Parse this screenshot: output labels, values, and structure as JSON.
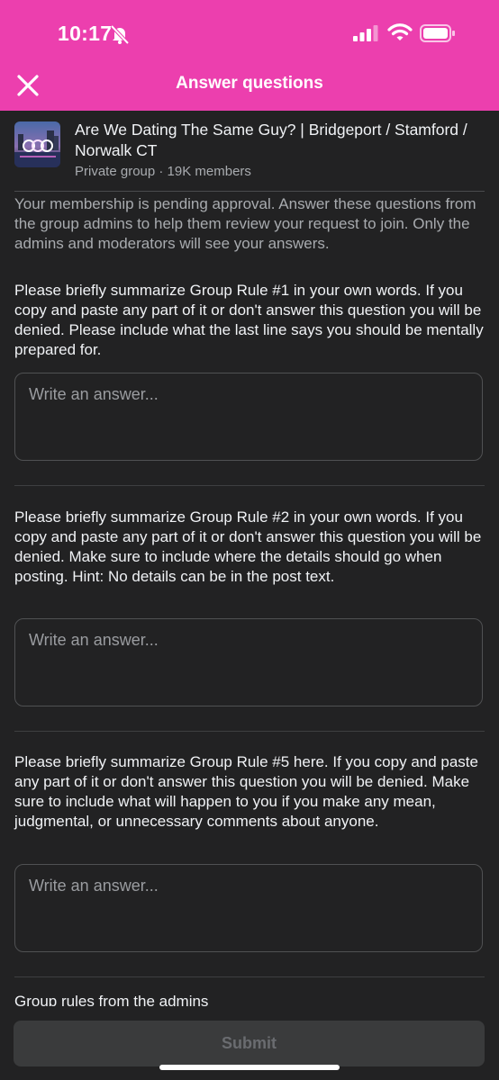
{
  "status_bar": {
    "time": "10:17",
    "icons": [
      "bell-slash-icon",
      "signal-icon",
      "wifi-icon",
      "battery-icon"
    ]
  },
  "header": {
    "title": "Answer questions",
    "close_icon": "close-icon",
    "background_color": "#ec3fae"
  },
  "group": {
    "name": "Are We Dating The Same Guy? | Bridgeport / Stamford / Norwalk CT",
    "meta": "Private group · 19K members"
  },
  "intro": "Your membership is pending approval. Answer these questions from the group admins to help them review your request to join. Only the admins and moderators will see your answers.",
  "questions": [
    {
      "text": "Please briefly summarize Group Rule #1 in your own words. If you copy and paste any part of it or don't answer this question you will be denied. Please include what the last line says you should be mentally prepared for.",
      "placeholder": "Write an answer..."
    },
    {
      "text": "Please briefly summarize Group Rule #2 in your own words. If you copy and paste any part of it or don't answer this question you will be denied. Make sure to include where the details should go when posting. Hint: No details can be in the post text.",
      "placeholder": "Write an answer..."
    },
    {
      "text": "Please briefly summarize Group Rule #5 here. If you copy and paste any part of it or don't answer this question you will be denied. Make sure to include what will happen to you if you make any mean, judgmental, or unnecessary comments about anyone.",
      "placeholder": "Write an answer..."
    }
  ],
  "rules_heading": "Group rules from the admins",
  "submit_label": "Submit"
}
